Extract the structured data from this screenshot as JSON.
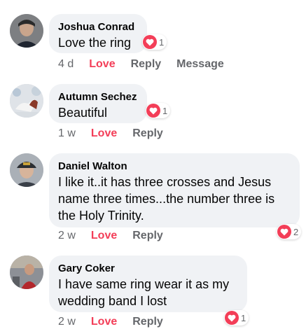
{
  "comments": [
    {
      "name": "Joshua Conrad",
      "lines": [
        "Love the ring"
      ],
      "time": "4 d",
      "love": "Love",
      "reply": "Reply",
      "message": "Message",
      "reaction_count": "1",
      "reaction": "love-heart-icon"
    },
    {
      "name": "Autumn Sechez",
      "lines": [
        "Beautiful"
      ],
      "time": "1 w",
      "love": "Love",
      "reply": "Reply",
      "reaction_count": "1",
      "reaction": "love-heart-icon"
    },
    {
      "name": "Daniel Walton",
      "lines": [
        "I like it..it has three crosses and Jesus",
        "name three times...the number three is",
        "the Holy Trinity."
      ],
      "time": "2 w",
      "love": "Love",
      "reply": "Reply",
      "reaction_count": "2",
      "reaction": "love-heart-icon"
    },
    {
      "name": "Gary Coker",
      "lines": [
        "I have same ring wear it as my",
        "wedding band I lost"
      ],
      "time": "2 w",
      "love": "Love",
      "reply": "Reply",
      "reaction_count": "1",
      "reaction": "love-heart-icon"
    }
  ],
  "colors": {
    "love": "#f33e58",
    "bubble": "#f0f2f5",
    "meta": "#65676b"
  }
}
